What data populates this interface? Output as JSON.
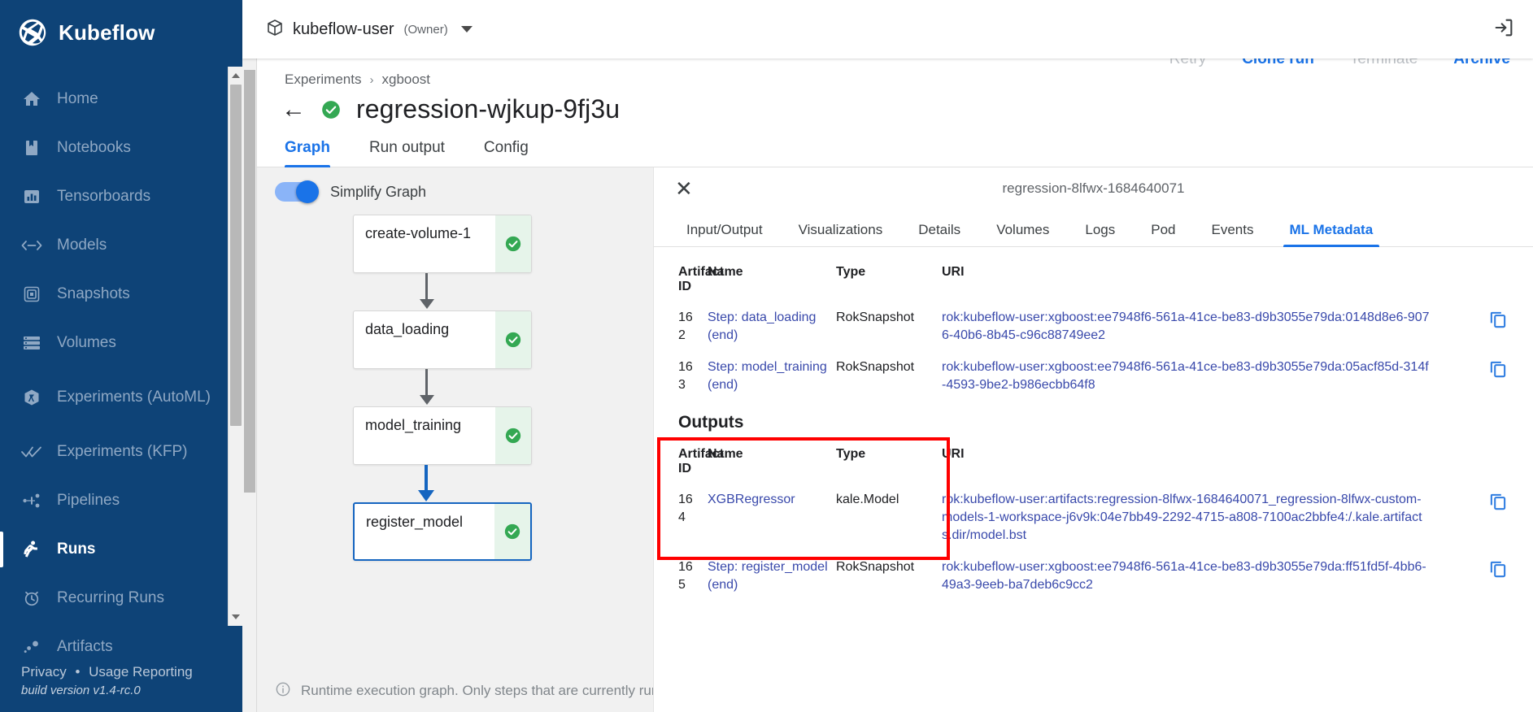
{
  "brand": {
    "name": "Kubeflow",
    "logo_icon": "kubeflow-logo-icon"
  },
  "sidebar": {
    "items": [
      {
        "label": "Home",
        "icon": "home-icon",
        "active": false
      },
      {
        "label": "Notebooks",
        "icon": "notebook-icon",
        "active": false
      },
      {
        "label": "Tensorboards",
        "icon": "bar-chart-icon",
        "active": false
      },
      {
        "label": "Models",
        "icon": "code-arrows-icon",
        "active": false
      },
      {
        "label": "Snapshots",
        "icon": "snapshot-icon",
        "active": false
      },
      {
        "label": "Volumes",
        "icon": "storage-icon",
        "active": false
      },
      {
        "label": "Experiments (AutoML)",
        "icon": "automl-icon",
        "active": false
      },
      {
        "label": "Experiments (KFP)",
        "icon": "double-check-icon",
        "active": false
      },
      {
        "label": "Pipelines",
        "icon": "pipeline-icon",
        "active": false
      },
      {
        "label": "Runs",
        "icon": "runs-icon",
        "active": true
      },
      {
        "label": "Recurring Runs",
        "icon": "alarm-clock-icon",
        "active": false
      },
      {
        "label": "Artifacts",
        "icon": "artifacts-icon",
        "active": false
      }
    ],
    "footer": {
      "privacy": "Privacy",
      "separator": "•",
      "usage_reporting": "Usage Reporting",
      "build": "build version v1.4-rc.0"
    }
  },
  "topbar": {
    "namespace_icon": "package-icon",
    "namespace": "kubeflow-user",
    "role": "(Owner)",
    "caret_icon": "chevron-down-icon",
    "logout_icon": "logout-icon"
  },
  "breadcrumb": {
    "items": [
      "Experiments",
      "xgboost"
    ],
    "separator": "›"
  },
  "run": {
    "back_icon": "back-arrow-icon",
    "status_icon": "status-success-icon",
    "title": "regression-wjkup-9fj3u",
    "actions": [
      {
        "label": "Retry",
        "enabled": false
      },
      {
        "label": "Clone run",
        "enabled": true
      },
      {
        "label": "Terminate",
        "enabled": false
      },
      {
        "label": "Archive",
        "enabled": true
      }
    ]
  },
  "main_tabs": [
    {
      "label": "Graph",
      "active": true
    },
    {
      "label": "Run output",
      "active": false
    },
    {
      "label": "Config",
      "active": false
    }
  ],
  "graph": {
    "simplify_toggle": {
      "label": "Simplify Graph",
      "on": true
    },
    "nodes": [
      {
        "label": "create-volume-1",
        "status": "success",
        "selected": false
      },
      {
        "label": "data_loading",
        "status": "success",
        "selected": false
      },
      {
        "label": "model_training",
        "status": "success",
        "selected": false
      },
      {
        "label": "register_model",
        "status": "success",
        "selected": true
      }
    ],
    "footnote_icon": "info-icon",
    "footnote": "Runtime execution graph. Only steps that are currently running"
  },
  "side_panel": {
    "close_icon": "close-icon",
    "title": "regression-8lfwx-1684640071",
    "tabs": [
      {
        "label": "Input/Output",
        "active": false
      },
      {
        "label": "Visualizations",
        "active": false
      },
      {
        "label": "Details",
        "active": false
      },
      {
        "label": "Volumes",
        "active": false
      },
      {
        "label": "Logs",
        "active": false
      },
      {
        "label": "Pod",
        "active": false
      },
      {
        "label": "Events",
        "active": false
      },
      {
        "label": "ML Metadata",
        "active": true
      }
    ],
    "inputs_table": {
      "headers": {
        "id": "Artifact ID",
        "name": "Name",
        "type": "Type",
        "uri": "URI"
      },
      "rows": [
        {
          "id": "162",
          "name": "Step: data_loading (end)",
          "type": "RokSnapshot",
          "uri": "rok:kubeflow-user:xgboost:ee7948f6-561a-41ce-be83-d9b3055e79da:0148d8e6-9076-40b6-8b45-c96c88749ee2",
          "copy_icon": "copy-icon"
        },
        {
          "id": "163",
          "name": "Step: model_training (end)",
          "type": "RokSnapshot",
          "uri": "rok:kubeflow-user:xgboost:ee7948f6-561a-41ce-be83-d9b3055e79da:05acf85d-314f-4593-9be2-b986ecbb64f8",
          "copy_icon": "copy-icon"
        }
      ]
    },
    "outputs_section_title": "Outputs",
    "outputs_table": {
      "headers": {
        "id": "Artifact ID",
        "name": "Name",
        "type": "Type",
        "uri": "URI"
      },
      "rows": [
        {
          "id": "164",
          "name": "XGBRegressor",
          "type": "kale.Model",
          "uri": "rok:kubeflow-user:artifacts:regression-8lfwx-1684640071_regression-8lfwx-custom-models-1-workspace-j6v9k:04e7bb49-2292-4715-a808-7100ac2bbfe4:/.kale.artifacts.dir/model.bst",
          "copy_icon": "copy-icon"
        },
        {
          "id": "165",
          "name": "Step: register_model (end)",
          "type": "RokSnapshot",
          "uri": "rok:kubeflow-user:xgboost:ee7948f6-561a-41ce-be83-d9b3055e79da:ff51fd5f-4bb6-49a3-9eeb-ba7deb6c9cc2",
          "copy_icon": "copy-icon"
        }
      ]
    },
    "highlight_annotation": {
      "color": "#ff0000",
      "target": "outputs-table-first-columns"
    }
  },
  "colors": {
    "sidebar_bg": "#0E4377",
    "accent_blue": "#1a73e8",
    "link_indigo": "#3949ab",
    "success_green": "#34a853",
    "highlight_red": "#ff0000"
  }
}
